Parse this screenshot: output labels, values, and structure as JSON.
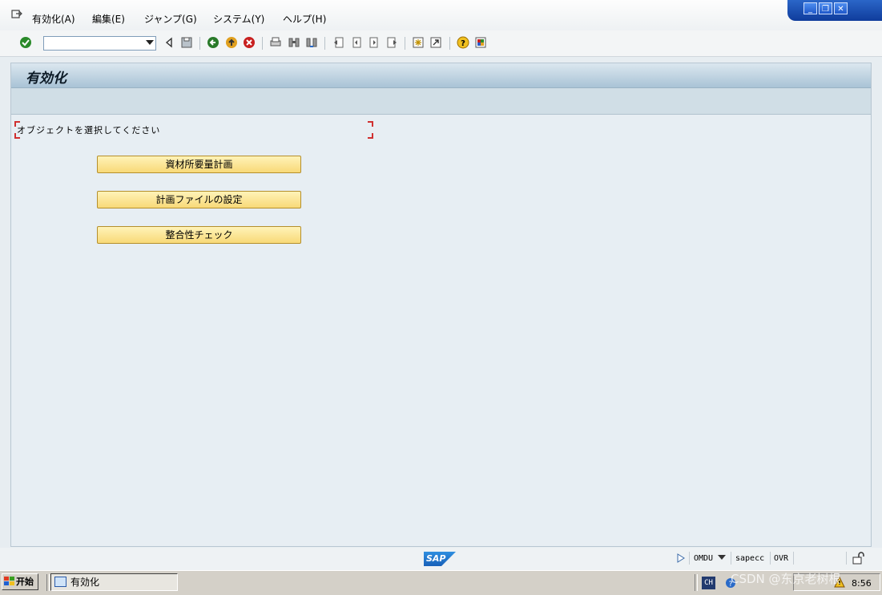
{
  "menu": {
    "items": [
      "有効化(A)",
      "編集(E)",
      "ジャンプ(G)",
      "システム(Y)",
      "ヘルプ(H)"
    ]
  },
  "window_controls": {
    "minimize": "_",
    "restore": "❐",
    "close": "✕"
  },
  "toolbar": {
    "command_value": "",
    "icons": [
      "enter-icon",
      "save-icon",
      "back-icon",
      "exit-icon",
      "cancel-icon",
      "print-icon",
      "find-icon",
      "find-next-icon",
      "first-page-icon",
      "previous-page-icon",
      "next-page-icon",
      "last-page-icon",
      "new-session-icon",
      "shortcut-icon",
      "help-icon",
      "customize-layout-icon"
    ]
  },
  "screen": {
    "title": "有効化",
    "instruction": "オブジェクトを選択してください",
    "buttons": [
      "資材所要量計画",
      "計画ファイルの設定",
      "整合性チェック"
    ]
  },
  "statusbar": {
    "logo": "SAP",
    "transaction": "OMDU",
    "server": "sapecc",
    "mode": "OVR"
  },
  "taskbar": {
    "start_label": "开始",
    "task_label": "有効化",
    "lang": "CH",
    "clock": "8:56"
  },
  "watermark": "CSDN @东京老树根",
  "colors": {
    "title_bar": "#a9c3d6",
    "button_fill": "#f8d978",
    "window_blue": "#1f58c9",
    "marker_red": "#d03030"
  }
}
